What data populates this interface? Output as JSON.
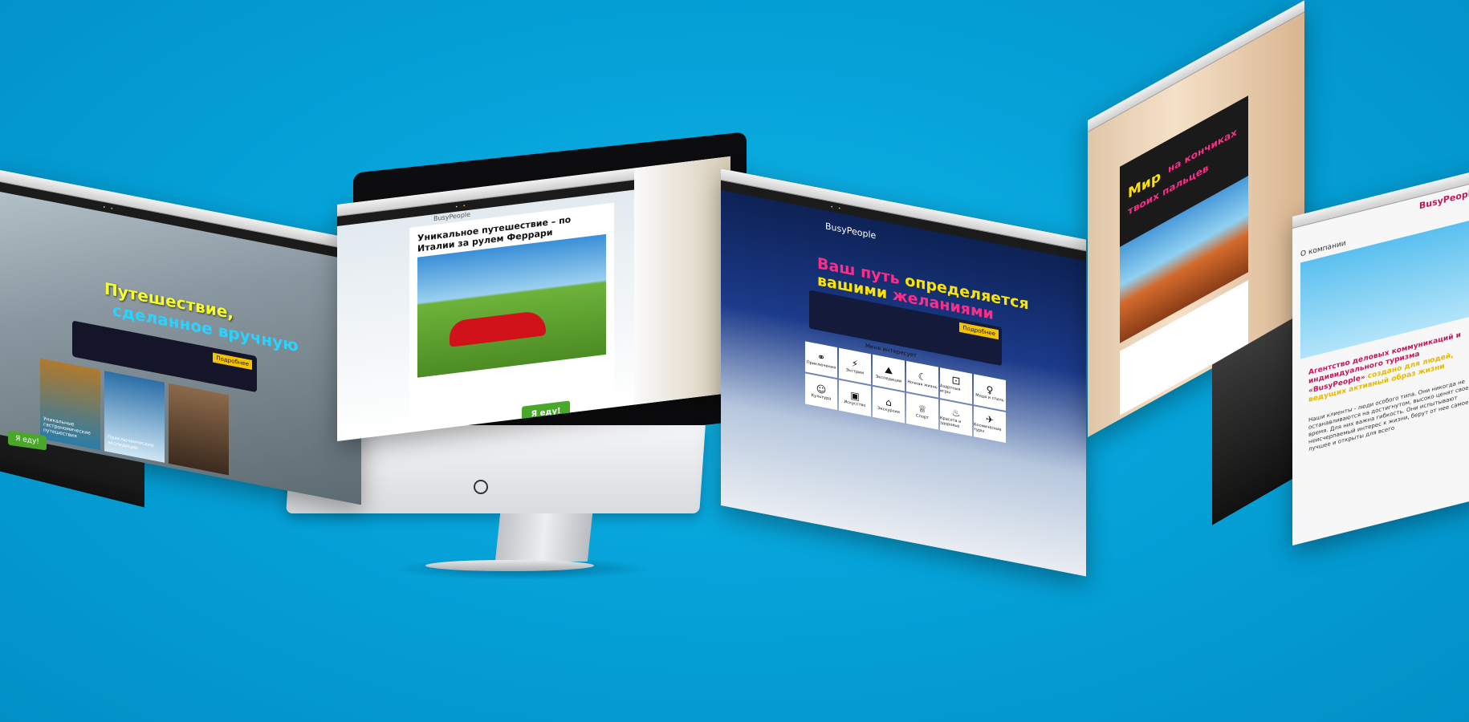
{
  "colors": {
    "background": "#05a3d9",
    "accent_yellow": "#f5c400",
    "accent_pink": "#ff2d8a",
    "button_green": "#49a72a"
  },
  "panel_travel": {
    "title_line1": "Путешествие,",
    "title_line2": "сделанное вручную",
    "badge": "Подробнее",
    "tile_labels": [
      "Уникальные гастрономические путешествия",
      "Приключенческие экспедиции"
    ],
    "side_button": "Я еду!"
  },
  "panel_ferrari": {
    "brand": "BusyPeople",
    "heading": "Уникальное путешествие – по Италии за рулем Феррари",
    "button": "Я еду!"
  },
  "panel_wishes": {
    "brand": "BusyPeople",
    "slogan_a": "Ваш путь",
    "slogan_b": "определяется",
    "slogan_c": "вашими",
    "slogan_d": "желаниями",
    "badge": "Подробнее",
    "interest_title": "Меня интересует",
    "grid": [
      {
        "icon": "⚭",
        "label": "Приключения"
      },
      {
        "icon": "⚡",
        "label": "Экстрим"
      },
      {
        "icon": "⛰",
        "label": "Экспедиции"
      },
      {
        "icon": "☾",
        "label": "Ночная жизнь"
      },
      {
        "icon": "⚀",
        "label": "Азартные игры"
      },
      {
        "icon": "♀",
        "label": "Мода и стиль"
      },
      {
        "icon": "☺",
        "label": "Культура"
      },
      {
        "icon": "▣",
        "label": "Искусство"
      },
      {
        "icon": "⌂",
        "label": "Экскурсии"
      },
      {
        "icon": "♕",
        "label": "Спорт"
      },
      {
        "icon": "♨",
        "label": "Красота и здоровье"
      },
      {
        "icon": "✈",
        "label": "Космические туры"
      }
    ]
  },
  "panel_fingers": {
    "title_a": "Мир",
    "title_b": "на кончиках",
    "title_c": "твоих пальцев"
  },
  "panel_about": {
    "brand": "BusyPeople",
    "about": "О компании",
    "agency_a": "Агентство деловых коммуникаций и индивидуального туризма «BusyPeople»",
    "agency_b": "создано для людей, ведущих активный образ жизни",
    "para": "Наши клиенты - люди особого типа. Они никогда не останавливаются на достигнутом, высоко ценят свое время. Для них важна гибкость. Они испытывают неисчерпаемый интерес к жизни, берут от нее самое лучшее и открыты для всего"
  }
}
